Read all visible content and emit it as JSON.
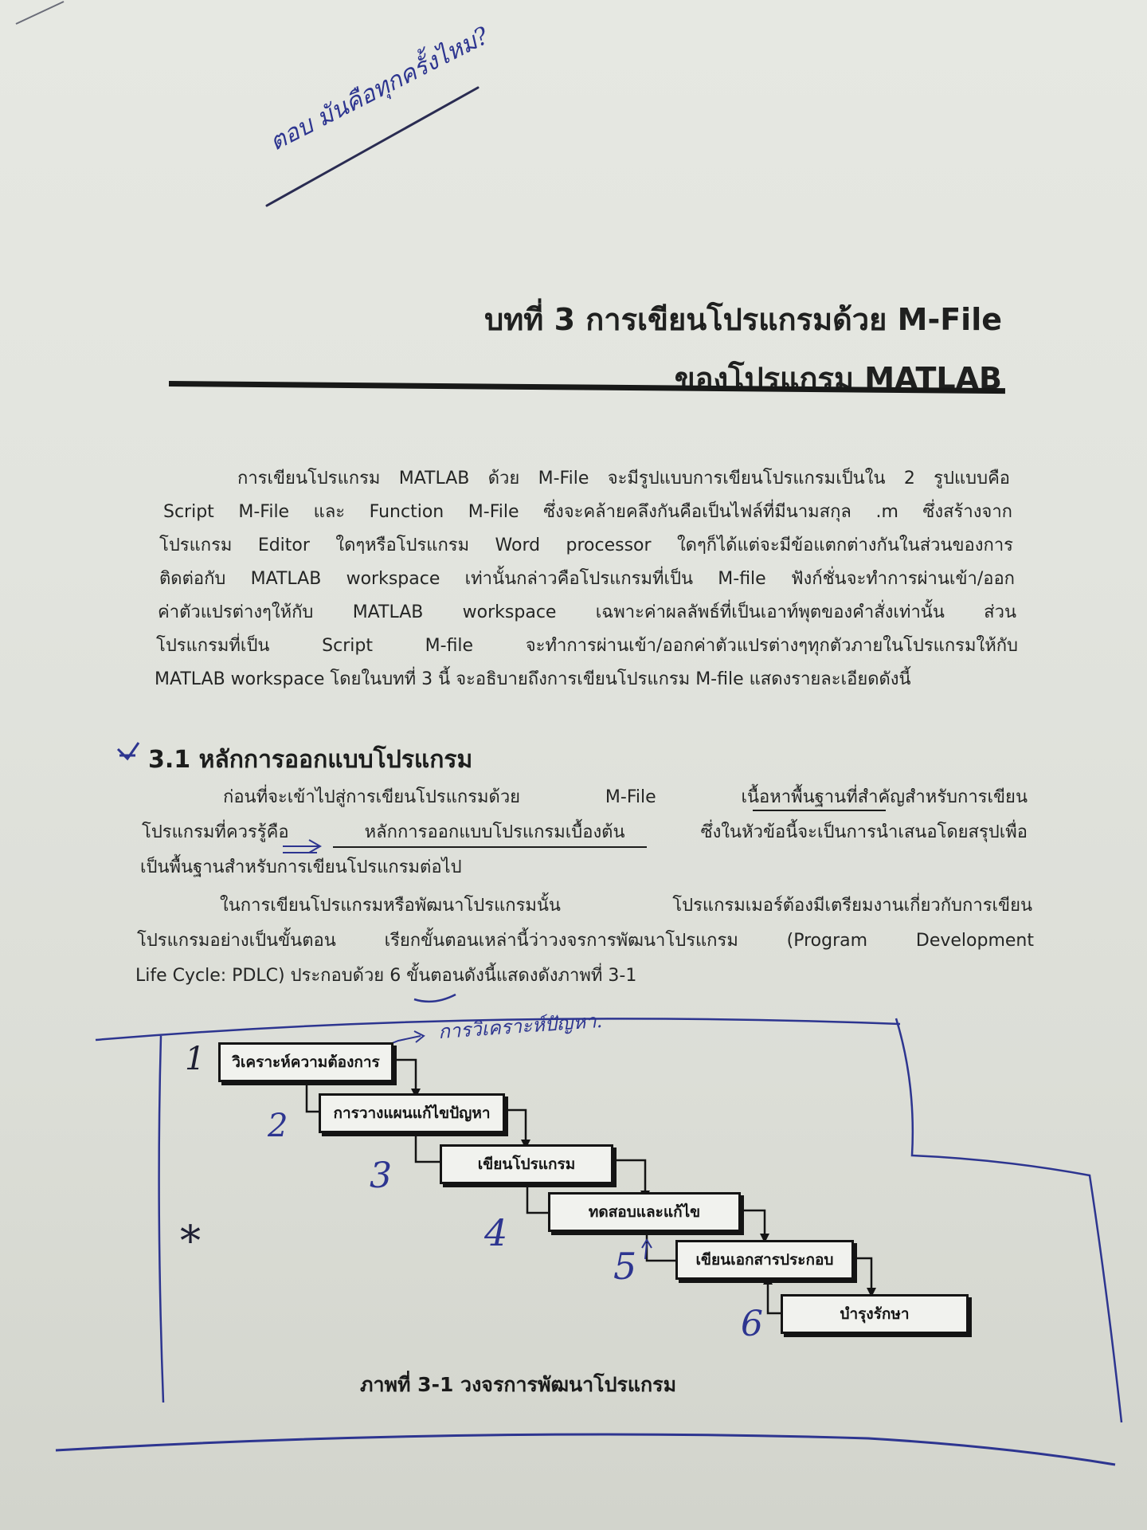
{
  "chapter": {
    "title_line1": "บทที่ 3 การเขียนโปรแกรมด้วย M-File",
    "title_line2": "ของโปรแกรม MATLAB"
  },
  "intro_paragraph": {
    "lines": [
      "การเขียนโปรแกรม MATLAB ด้วย M-File จะมีรูปแบบการเขียนโปรแกรมเป็นใน 2 รูปแบบคือ",
      "Script M-File และ Function M-File ซึ่งจะคล้ายคลึงกันคือเป็นไฟล์ที่มีนามสกุล .m ซึ่งสร้างจาก",
      "โปรแกรม Editor ใดๆหรือโปรแกรม Word processor ใดๆก็ได้แต่จะมีข้อแตกต่างกันในส่วนของการ",
      "ติดต่อกับ MATLAB workspace เท่านั้นกล่าวคือโปรแกรมที่เป็น M-file ฟังก์ชั่นจะทำการผ่านเข้า/ออก",
      "ค่าตัวแปรต่างๆให้กับ MATLAB workspace เฉพาะค่าผลลัพธ์ที่เป็นเอาท์พุตของคำสั่งเท่านั้น ส่วน",
      "โปรแกรมที่เป็น Script M-file จะทำการผ่านเข้า/ออกค่าตัวแปรต่างๆทุกตัวภายในโปรแกรมให้กับ",
      "MATLAB workspace โดยในบทที่ 3 นี้ จะอธิบายถึงการเขียนโปรแกรม M-file แสดงรายละเอียดดังนี้"
    ]
  },
  "section": {
    "heading": "3.1 หลักการออกแบบโปรแกรม",
    "paragraph1": [
      "ก่อนที่จะเข้าไปสู่การเขียนโปรแกรมด้วย M-File เนื้อหาพื้นฐานที่สำคัญสำหรับการเขียน",
      "โปรแกรมที่ควรรู้คือ หลักการออกแบบโปรแกรมเบื้องต้น ซึ่งในหัวข้อนี้จะเป็นการนำเสนอโดยสรุปเพื่อ",
      "เป็นพื้นฐานสำหรับการเขียนโปรแกรมต่อไป"
    ],
    "paragraph2": [
      "ในการเขียนโปรแกรมหรือพัฒนาโปรแกรมนั้น โปรแกรมเมอร์ต้องมีเตรียมงานเกี่ยวกับการเขียน",
      "โปรแกรมอย่างเป็นขั้นตอน เรียกขั้นตอนเหล่านี้ว่าวงจรการพัฒนาโปรแกรม (Program Development",
      "Life Cycle: PDLC) ประกอบด้วย 6 ขั้นตอนดังนี้แสดงดังภาพที่ 3-1"
    ]
  },
  "diagram": {
    "steps": [
      "วิเคราะห์ความต้องการ",
      "การวางแผนแก้ไขปัญหา",
      "เขียนโปรแกรม",
      "ทดสอบและแก้ไข",
      "เขียนเอกสารประกอบ",
      "บำรุงรักษา"
    ],
    "caption": "ภาพที่ 3-1  วงจรการพัฒนาโปรแกรม"
  },
  "handwriting": {
    "top_note": "ตอบ มันคือทุกครั้งไหม?",
    "step_note": "การวิเคราะห์ปัญหา.",
    "numbers": [
      "1",
      "2",
      "3",
      "4",
      "5",
      "6"
    ],
    "asterisk": "*"
  },
  "colors": {
    "ink": "#2d3590",
    "print": "#1c1d1c",
    "paper": "#e2e4de"
  }
}
